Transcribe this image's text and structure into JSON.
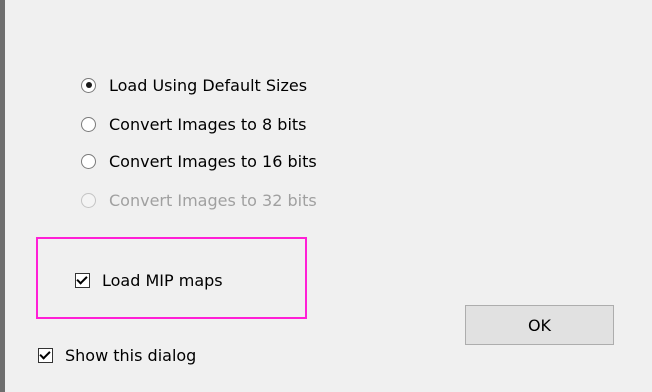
{
  "options": [
    {
      "label": "Load Using Default Sizes",
      "selected": true,
      "enabled": true
    },
    {
      "label": "Convert Images to 8 bits",
      "selected": false,
      "enabled": true
    },
    {
      "label": "Convert Images to 16 bits",
      "selected": false,
      "enabled": true
    },
    {
      "label": "Convert Images to 32 bits",
      "selected": false,
      "enabled": false
    }
  ],
  "load_mip_maps": {
    "label": "Load MIP maps",
    "checked": true
  },
  "show_dialog": {
    "label": "Show this dialog",
    "checked": true
  },
  "ok_button": {
    "label": "OK"
  },
  "colors": {
    "highlight": "#ff1fd6",
    "dialog_background": "#f0f0f0",
    "disabled_text": "#a0a0a0"
  }
}
